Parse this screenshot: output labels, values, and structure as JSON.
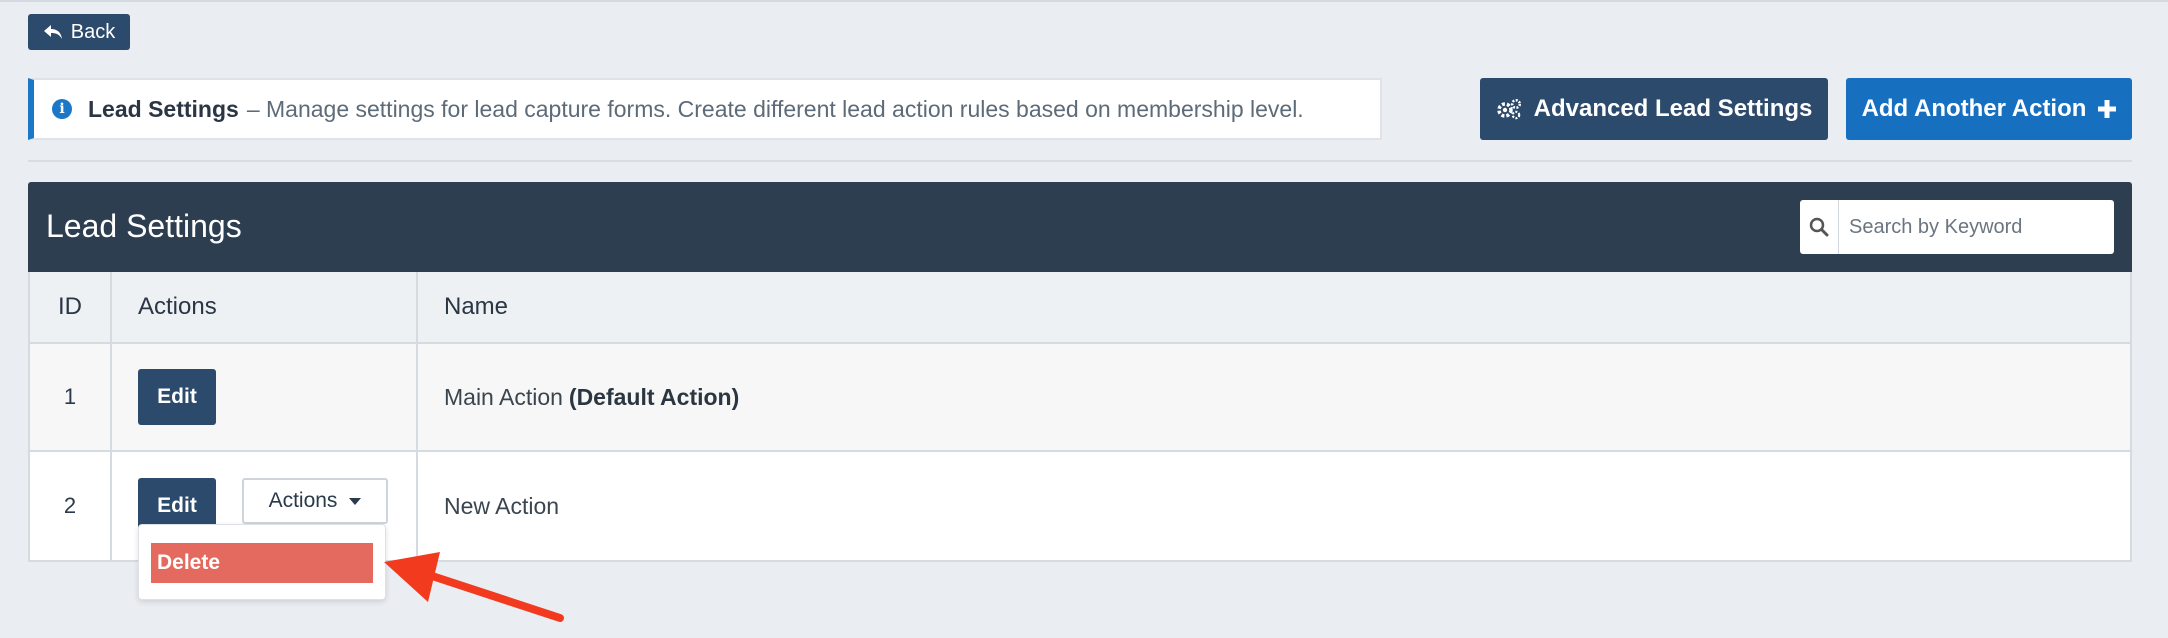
{
  "back": {
    "label": "Back"
  },
  "info": {
    "title": "Lead Settings",
    "text": "– Manage settings for lead capture forms. Create different lead action rules based on membership level."
  },
  "toolbar": {
    "advanced_label": "Advanced Lead Settings",
    "add_label": "Add Another Action"
  },
  "panel": {
    "title": "Lead Settings",
    "search_placeholder": "Search by Keyword"
  },
  "table": {
    "headers": {
      "id": "ID",
      "actions": "Actions",
      "name": "Name"
    },
    "rows": [
      {
        "id": "1",
        "edit_label": "Edit",
        "name": "Main Action",
        "name_suffix": "(Default Action)"
      },
      {
        "id": "2",
        "edit_label": "Edit",
        "actions_label": "Actions",
        "name": "New Action"
      }
    ]
  },
  "dropdown": {
    "delete_label": "Delete"
  },
  "colors": {
    "primary": "#2c4a6b",
    "accent": "#1670bf",
    "danger": "#e46a5f",
    "arrow": "#f23a1f"
  }
}
